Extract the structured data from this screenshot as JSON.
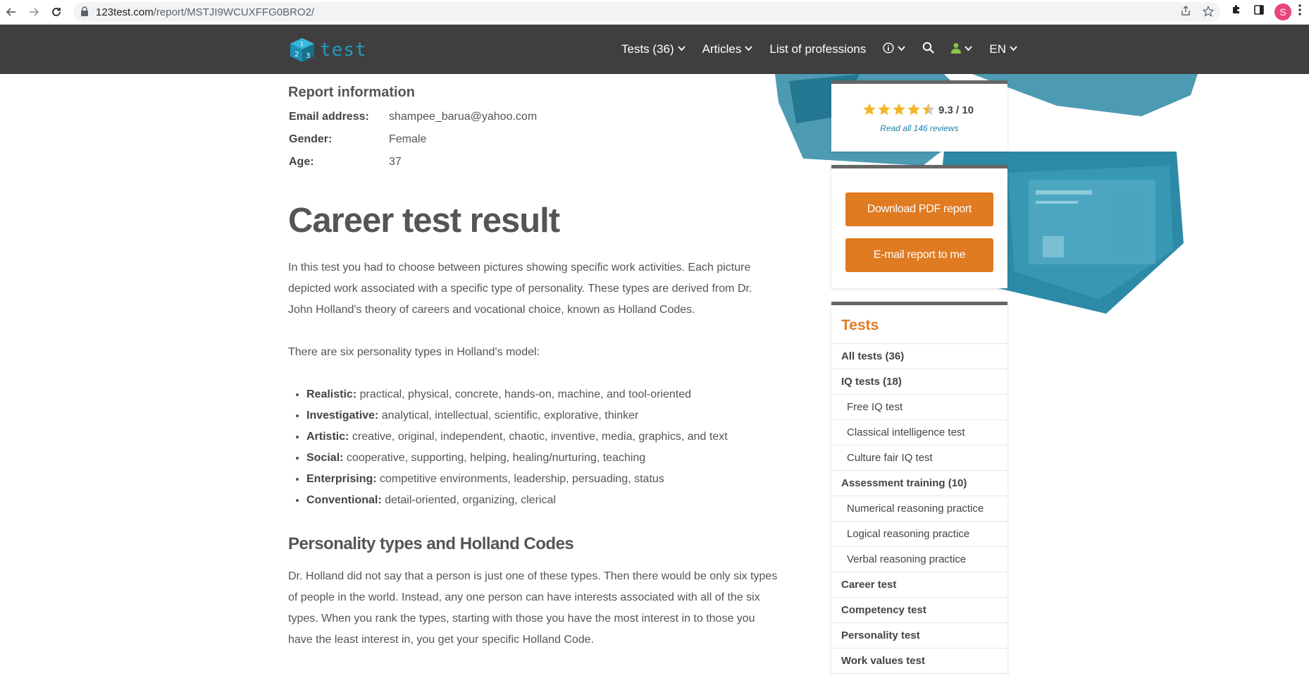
{
  "browser": {
    "url_domain": "123test.com",
    "url_path": "/report/MSTJI9WCUXFFG0BRO2/",
    "profile_initial": "S"
  },
  "header": {
    "logo_text": "test",
    "nav": [
      {
        "label": "Tests (36)",
        "has_dropdown": true
      },
      {
        "label": "Articles",
        "has_dropdown": true
      },
      {
        "label": "List of professions",
        "has_dropdown": false
      }
    ],
    "language": "EN"
  },
  "report_info": {
    "title": "Report information",
    "rows": [
      {
        "key": "Email address:",
        "value": "shampee_barua@yahoo.com"
      },
      {
        "key": "Gender:",
        "value": "Female"
      },
      {
        "key": "Age:",
        "value": "37"
      }
    ]
  },
  "main": {
    "title": "Career test result",
    "intro_lines": [
      "In this test you had to choose between pictures showing specific work activities. Each picture",
      "depicted work associated with a specific type of personality. These types are derived from Dr.",
      "John Holland's theory of careers and vocational choice, known as Holland Codes."
    ],
    "six_types_line": "There are six personality types in Holland's model:",
    "types": [
      {
        "name": "Realistic:",
        "desc": " practical, physical, concrete, hands-on, machine, and tool-oriented"
      },
      {
        "name": "Investigative:",
        "desc": " analytical, intellectual, scientific, explorative, thinker"
      },
      {
        "name": "Artistic:",
        "desc": " creative, original, independent, chaotic, inventive, media, graphics, and text"
      },
      {
        "name": "Social:",
        "desc": " cooperative, supporting, helping, healing/nurturing, teaching"
      },
      {
        "name": "Enterprising:",
        "desc": " competitive environments, leadership, persuading, status"
      },
      {
        "name": "Conventional:",
        "desc": " detail-oriented, organizing, clerical"
      }
    ],
    "subtitle": "Personality types and Holland Codes",
    "holland_lines": [
      "Dr. Holland did not say that a person is just one of these types. Then there would be only six types",
      "of people in the world. Instead, any one person can have interests associated with all of the six",
      "types. When you rank the types, starting with those you have the most interest in to those you",
      "have the least interest in, you get your specific Holland Code."
    ]
  },
  "sidebar": {
    "rating": {
      "score": "9.3 / 10",
      "stars": 4.5,
      "reviews_link": "Read all 146 reviews",
      "star_color": "#f3b624"
    },
    "buttons": {
      "download": "Download PDF report",
      "email": "E-mail report to me"
    },
    "tests_title": "Tests",
    "tests": [
      {
        "label": "All tests (36)",
        "bold": true
      },
      {
        "label": "IQ tests (18)",
        "bold": true
      },
      {
        "label": "Free IQ test",
        "bold": false
      },
      {
        "label": "Classical intelligence test",
        "bold": false
      },
      {
        "label": "Culture fair IQ test",
        "bold": false
      },
      {
        "label": "Assessment training (10)",
        "bold": true
      },
      {
        "label": "Numerical reasoning practice",
        "bold": false
      },
      {
        "label": "Logical reasoning practice",
        "bold": false
      },
      {
        "label": "Verbal reasoning practice",
        "bold": false
      },
      {
        "label": "Career test",
        "bold": true
      },
      {
        "label": "Competency test",
        "bold": true
      },
      {
        "label": "Personality test",
        "bold": true
      },
      {
        "label": "Work values test",
        "bold": true
      }
    ]
  },
  "colors": {
    "accent": "#e07b22",
    "header_bg": "#3f3f3f",
    "brand": "#1f9bbf"
  }
}
